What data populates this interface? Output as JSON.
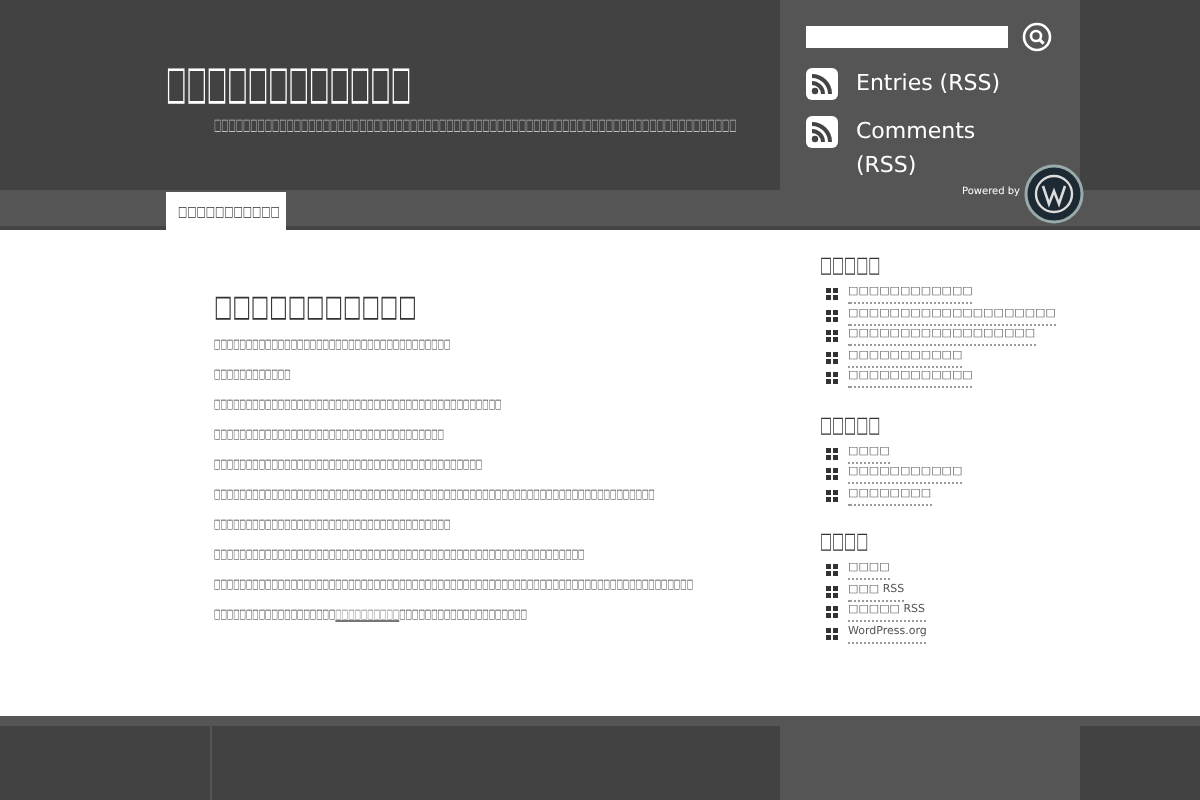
{
  "header": {
    "title": "□□□□□□□□□□□□",
    "tagline": "□□□□□□□□□□□□□□□□□□□□□□□□□□□□□□□□□□□□□□□□□□□□□□□□□□□□□□□□□□□□□□□□□□□□□□□□"
  },
  "feeds": [
    {
      "label": "Entries (RSS)"
    },
    {
      "label": "Comments (RSS)"
    }
  ],
  "powered_by": "Powered by",
  "nav": [
    {
      "label": "□□□□□□□□□□□",
      "selected": true
    }
  ],
  "post": {
    "title": "□□□□□□□□□□□",
    "paragraphs": [
      {
        "text": "□□□□□□□□□□□□□□□□□□□□□□□□□□□□□□□□□□□□□"
      },
      {
        "text": "□□□□□□□□□□□□"
      },
      {
        "text": "□□□□□□□□□□□□□□□□□□□□□□□□□□□□□□□□□□□□□□□□□□□□□"
      },
      {
        "text": "□□□□□□□□□□□□□□□□□□□□□□□□□□□□□□□□□□□□"
      },
      {
        "text": "□□□□□□□□□□□□□□□□□□□□□□□□□□□□□□□□□□□□□□□□□□"
      },
      {
        "text": "□□□□□□□□□□□□□□□□□□□□□□□□□□□□□□□□□□□□□□□□□□□□□□□□□□□□□□□□□□□□□□□□□□□□□"
      },
      {
        "text": "□□□□□□□□□□□□□□□□□□□□□□□□□□□□□□□□□□□□□"
      },
      {
        "text": "□□□□□□□□□□□□□□□□□□□□□□□□□□□□□□□□□□□□□□□□□□□□□□□□□□□□□□□□□□"
      },
      {
        "text": "□□□□□□□□□□□□□□□□□□□□□□□□□□□□□□□□□□□□□□□□□□□□□□□□□□□□□□□□□□□□□□□□□□□□□□□□□□□"
      },
      {
        "text": "□□□□□□□□□□□□□□□□□□□",
        "link": "□□□□□□□□□□",
        "after": "□□□□□□□□□□□□□□□□□□□□"
      }
    ]
  },
  "sidebar": [
    {
      "title": "□□□□□",
      "items": [
        "□□□□□□□□□□□□",
        "□□□□□□□□□□□□□□□□□□□□",
        "□□□□□□□□□□□□□□□□□□",
        "□□□□□□□□□□□",
        "□□□□□□□□□□□□"
      ]
    },
    {
      "title": "□□□□□",
      "items": [
        "□□□□",
        "□□□□□□□□□□□",
        "□□□□□□□□"
      ]
    },
    {
      "title": "□□□□",
      "items": [
        "□□□□",
        "□□□ RSS",
        "□□□□□ RSS",
        "WordPress.org"
      ]
    }
  ]
}
